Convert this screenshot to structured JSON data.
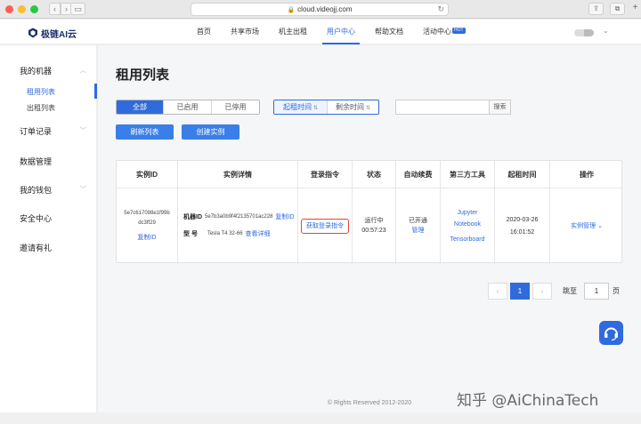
{
  "browser": {
    "url": "cloud.videojj.com",
    "back_glyph": "‹",
    "forward_glyph": "›",
    "reload_glyph": "↻"
  },
  "site": {
    "logo_text": "极链AI云",
    "nav": [
      {
        "label": "首页"
      },
      {
        "label": "共享市场"
      },
      {
        "label": "机主出租"
      },
      {
        "label": "用户中心"
      },
      {
        "label": "帮助文档"
      },
      {
        "label": "活动中心",
        "badge": "HOT"
      }
    ],
    "active_nav": "用户中心"
  },
  "sidebar": {
    "groups": [
      {
        "label": "我的机器",
        "expanded": true,
        "children": [
          {
            "label": "租用列表",
            "active": true
          },
          {
            "label": "出租列表"
          }
        ]
      },
      {
        "label": "订单记录",
        "chevron": true
      },
      {
        "label": "数据管理"
      },
      {
        "label": "我的钱包",
        "chevron": true
      },
      {
        "label": "安全中心"
      },
      {
        "label": "邀请有礼"
      }
    ]
  },
  "main": {
    "title": "租用列表",
    "status_filter": {
      "options": [
        "全部",
        "已启用",
        "已停用"
      ],
      "selected": "全部"
    },
    "sort_filter": {
      "options": [
        "起租时间",
        "剩余时间"
      ],
      "selected": "起租时间"
    },
    "search": {
      "placeholder": "",
      "button": "搜索"
    },
    "buttons": {
      "refresh": "刷新列表",
      "create": "创建实例"
    },
    "table": {
      "headers": [
        "实例ID",
        "实例详情",
        "登录指令",
        "状态",
        "自动续费",
        "第三方工具",
        "起租时间",
        "操作"
      ],
      "rows": [
        {
          "instance_id_line1": "5e7c617098e1f99b",
          "instance_id_line2": "dc3ff29",
          "copy_id": "复制ID",
          "machine_label": "机器ID",
          "machine_id": "5e7b3a0b9f4f2135701ac228",
          "machine_copy": "复制ID",
          "model_label": "型 号",
          "model": "Tesla T4 32-66",
          "view_detail": "查看详细",
          "login_cmd": "获取登录指令",
          "status": "运行中",
          "elapsed": "00:57:23",
          "auto_renew": "已开通",
          "auto_renew_manage": "管理",
          "tools": [
            "Jupyter",
            "Notebook",
            "Tensorboard"
          ],
          "start_date": "2020-03-26",
          "start_time": "16:01:52",
          "action": "实例管理"
        }
      ]
    },
    "pagination": {
      "current": "1",
      "jump_label": "跳至",
      "jump_value": "1",
      "page_label": "页",
      "prev": "‹",
      "next": "›"
    },
    "footer": "© Rights Reserved 2012-2020"
  },
  "watermark": "知乎 @AiChinaTech",
  "colors": {
    "primary": "#2f6bdc",
    "highlight_border": "#e0472e"
  }
}
